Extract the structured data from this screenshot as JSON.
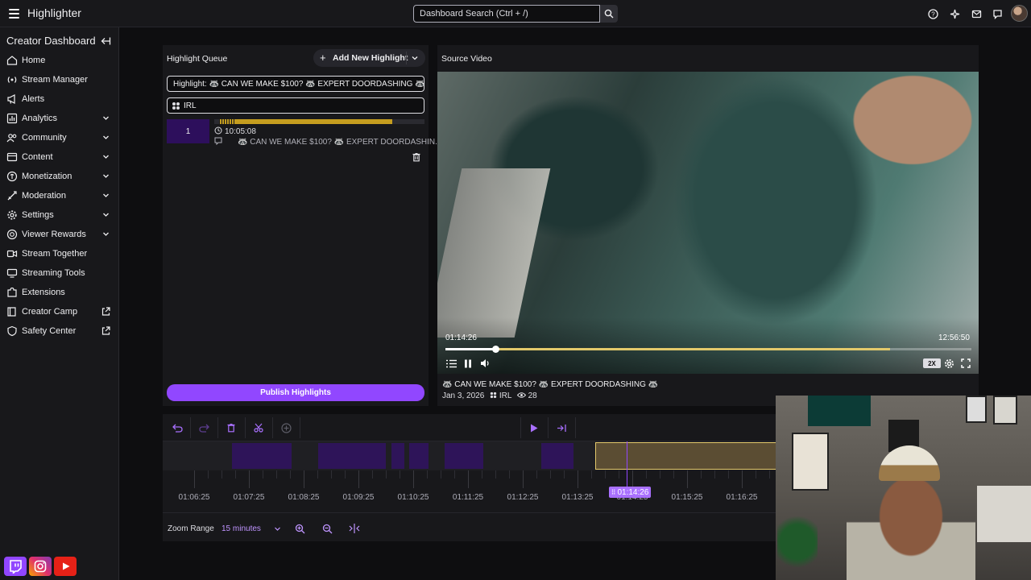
{
  "topbar": {
    "app_title": "Highlighter",
    "search_placeholder": "Dashboard Search (Ctrl + /)",
    "icons": [
      "help-icon",
      "sparkle-icon",
      "inbox-icon",
      "chat-icon",
      "crown-icon"
    ]
  },
  "sidebar": {
    "header": "Creator Dashboard",
    "items": [
      {
        "label": "Home",
        "icon": "home-icon",
        "expandable": false,
        "external": false
      },
      {
        "label": "Stream Manager",
        "icon": "broadcast-icon",
        "expandable": false,
        "external": false
      },
      {
        "label": "Alerts",
        "icon": "megaphone-icon",
        "expandable": false,
        "external": false
      },
      {
        "label": "Analytics",
        "icon": "analytics-icon",
        "expandable": true,
        "external": false
      },
      {
        "label": "Community",
        "icon": "community-icon",
        "expandable": true,
        "external": false
      },
      {
        "label": "Content",
        "icon": "content-icon",
        "expandable": true,
        "external": false
      },
      {
        "label": "Monetization",
        "icon": "monetization-icon",
        "expandable": true,
        "external": false
      },
      {
        "label": "Moderation",
        "icon": "sword-icon",
        "expandable": true,
        "external": false
      },
      {
        "label": "Settings",
        "icon": "gear-icon",
        "expandable": true,
        "external": false
      },
      {
        "label": "Viewer Rewards",
        "icon": "rewards-icon",
        "expandable": true,
        "external": false
      },
      {
        "label": "Stream Together",
        "icon": "stream-together-icon",
        "expandable": false,
        "external": false
      },
      {
        "label": "Streaming Tools",
        "icon": "tools-icon",
        "expandable": false,
        "external": false
      },
      {
        "label": "Extensions",
        "icon": "puzzle-icon",
        "expandable": false,
        "external": false
      },
      {
        "label": "Creator Camp",
        "icon": "book-icon",
        "expandable": false,
        "external": true
      },
      {
        "label": "Safety Center",
        "icon": "shield-icon",
        "expandable": false,
        "external": true
      }
    ]
  },
  "queue": {
    "title": "Highlight Queue",
    "add_button": "Add New Highlight",
    "title_field": "Highlight: 🦝 CAN WE MAKE $100? 🦝 EXPERT DOORDASHING 🦝",
    "category_field": "IRL",
    "clip": {
      "number": "1",
      "time": "10:05:08",
      "title": "🦝 CAN WE MAKE $100? 🦝 EXPERT DOORDASHIN..."
    },
    "publish_button": "Publish Highlights"
  },
  "source": {
    "title": "Source Video",
    "current_time": "01:14:26",
    "duration": "12:56:50",
    "speed": "2X",
    "progress_fraction": 0.095,
    "highlight_end_fraction": 0.845,
    "video_title": "🦝 CAN WE MAKE $100? 🦝 EXPERT DOORDASHING 🦝",
    "date": "Jan 3, 2026",
    "category": "IRL",
    "views": "28"
  },
  "timeline": {
    "tick_labels": [
      "01:06:25",
      "01:07:25",
      "01:08:25",
      "01:09:25",
      "01:10:25",
      "01:11:25",
      "01:12:25",
      "01:13:25",
      "01:14:25",
      "01:15:25",
      "01:16:25"
    ],
    "playhead_label": "01:14:26",
    "zoom_label": "Zoom Range",
    "zoom_value": "15 minutes"
  },
  "colors": {
    "accent": "#9147ff",
    "highlight_gold": "#e3c96b",
    "background": "#0e0e10",
    "panel": "#18181b"
  }
}
